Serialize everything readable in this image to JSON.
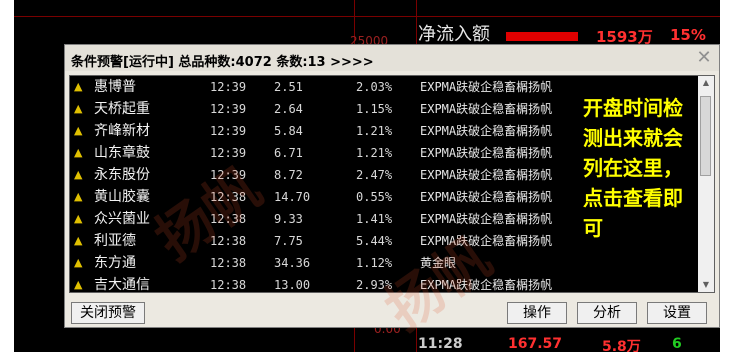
{
  "background": {
    "netflow_label": "净流入额",
    "netflow_value": "1593万",
    "netflow_pct": "15%",
    "price_level": "25000",
    "bottom_time": "11:28",
    "bottom_price": "167.57",
    "bottom_volume": "5.8万",
    "bottom_green": "6",
    "misc_value": "0.00"
  },
  "dialog": {
    "title": "条件预警[运行中] 总品种数:4072 条数:13  >>>>",
    "close_glyph": "✕",
    "rows": [
      {
        "star": "▲",
        "name": "惠博普",
        "time": "12:39",
        "price": "2.51",
        "pct": "2.03%",
        "condition": "EXPMA趺破企稳畜榍扬帆"
      },
      {
        "star": "▲",
        "name": "天桥起重",
        "time": "12:39",
        "price": "2.64",
        "pct": "1.15%",
        "condition": "EXPMA趺破企稳畜榍扬帆"
      },
      {
        "star": "▲",
        "name": "齐峰新材",
        "time": "12:39",
        "price": "5.84",
        "pct": "1.21%",
        "condition": "EXPMA趺破企稳畜榍扬帆"
      },
      {
        "star": "▲",
        "name": "山东章鼓",
        "time": "12:39",
        "price": "6.71",
        "pct": "1.21%",
        "condition": "EXPMA趺破企稳畜榍扬帆"
      },
      {
        "star": "▲",
        "name": "永东股份",
        "time": "12:39",
        "price": "8.72",
        "pct": "2.47%",
        "condition": "EXPMA趺破企稳畜榍扬帆"
      },
      {
        "star": "▲",
        "name": "黄山胶囊",
        "time": "12:38",
        "price": "14.70",
        "pct": "0.55%",
        "condition": "EXPMA趺破企稳畜榍扬帆"
      },
      {
        "star": "▲",
        "name": "众兴菌业",
        "time": "12:38",
        "price": "9.33",
        "pct": "1.41%",
        "condition": "EXPMA趺破企稳畜榍扬帆"
      },
      {
        "star": "▲",
        "name": "利亚德",
        "time": "12:38",
        "price": "7.75",
        "pct": "5.44%",
        "condition": "EXPMA趺破企稳畜榍扬帆"
      },
      {
        "star": "▲",
        "name": "东方通",
        "time": "12:38",
        "price": "34.36",
        "pct": "1.12%",
        "condition": "黄金眼"
      },
      {
        "star": "▲",
        "name": "吉大通信",
        "time": "12:38",
        "price": "13.00",
        "pct": "2.93%",
        "condition": "EXPMA趺破企稳畜榍扬帆"
      }
    ],
    "annotation": "开盘时间检测出来就会列在这里，点击查看即可",
    "buttons": {
      "close_alert": "关闭预警",
      "operate": "操作",
      "analyze": "分析",
      "settings": "设置"
    }
  },
  "watermark": "扬帆"
}
